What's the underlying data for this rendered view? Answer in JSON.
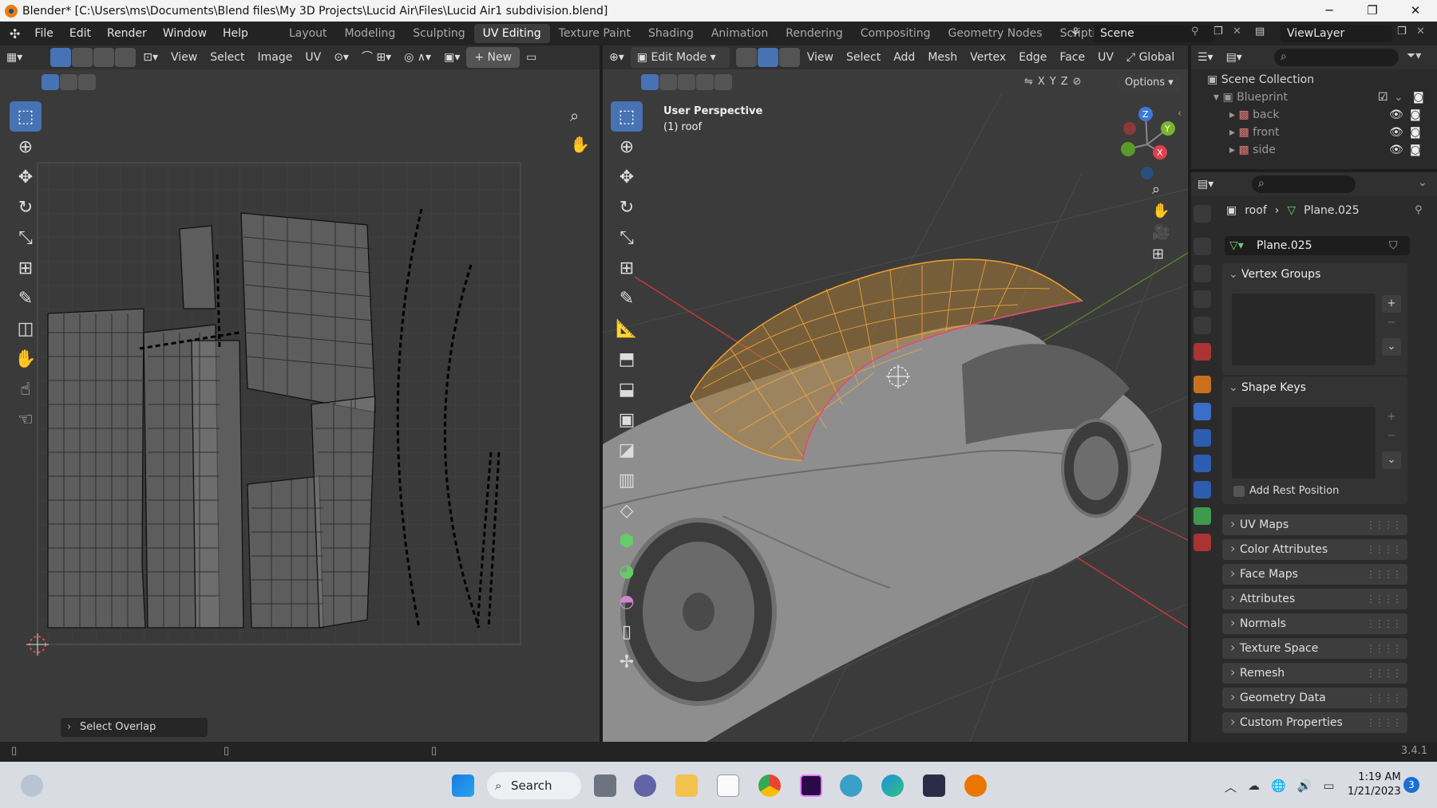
{
  "window": {
    "title": "Blender* [C:\\Users\\ms\\Documents\\Blend files\\My 3D Projects\\Lucid Air\\Files\\Lucid Air1 subdivision.blend]",
    "controls": [
      "─",
      "❐",
      "✕"
    ]
  },
  "menu": [
    "File",
    "Edit",
    "Render",
    "Window",
    "Help"
  ],
  "workspaces": [
    "Layout",
    "Modeling",
    "Sculpting",
    "UV Editing",
    "Texture Paint",
    "Shading",
    "Animation",
    "Rendering",
    "Compositing",
    "Geometry Nodes",
    "Scripting",
    "+"
  ],
  "active_workspace": "UV Editing",
  "scene": "Scene",
  "view_layer": "ViewLayer",
  "uv_editor": {
    "menus": [
      "View",
      "Select",
      "Image",
      "UV"
    ],
    "new_label": "New",
    "last_op": "Select Overlap"
  },
  "viewport": {
    "mode": "Edit Mode",
    "menus": [
      "View",
      "Select",
      "Add",
      "Mesh",
      "Vertex",
      "Edge",
      "Face",
      "UV"
    ],
    "orientation": "Global",
    "axes": [
      "X",
      "Y",
      "Z"
    ],
    "options_label": "Options",
    "overlay_line1": "User Perspective",
    "overlay_line2": "(1) roof",
    "gizmo": {
      "x": "X",
      "y": "Y",
      "z": "Z"
    }
  },
  "outliner": {
    "root": "Scene Collection",
    "collection": "Blueprint",
    "items": [
      "back",
      "front",
      "side"
    ]
  },
  "properties": {
    "breadcrumb_object": "roof",
    "breadcrumb_data": "Plane.025",
    "data_name": "Plane.025",
    "open_sections": [
      "Vertex Groups",
      "Shape Keys"
    ],
    "checkbox_label": "Add Rest Position",
    "sections": [
      "UV Maps",
      "Color Attributes",
      "Face Maps",
      "Attributes",
      "Normals",
      "Texture Space",
      "Remesh",
      "Geometry Data",
      "Custom Properties"
    ]
  },
  "status": {
    "version": "3.4.1"
  },
  "taskbar": {
    "search_label": "Search",
    "time": "1:19 AM",
    "date": "1/21/2023",
    "notification_count": "3"
  }
}
